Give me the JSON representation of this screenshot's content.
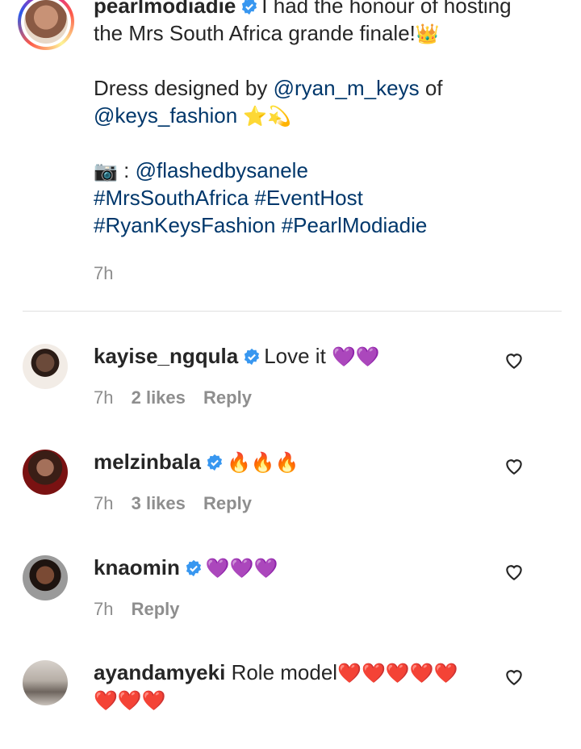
{
  "post": {
    "username": "pearlmodiadie",
    "text_line1": "I had the honour of hosting",
    "text_line2": "the Mrs South Africa grande finale!",
    "crown_emoji": "👑",
    "dress_prefix": "Dress designed by",
    "designer_handle": "@ryan_m_keys",
    "dress_of": "of",
    "brand_handle": "@keys_fashion",
    "star_emojis": "⭐💫",
    "camera_emoji": "📷",
    "photo_sep": ":",
    "photographer_handle": "@flashedbysanele",
    "hashtag1": "#MrsSouthAfrica",
    "hashtag2": "#EventHost",
    "hashtag3": "#RyanKeysFashion",
    "hashtag4": "#PearlModiadie",
    "time": "7h"
  },
  "comments": [
    {
      "username": "kayise_ngqula",
      "text": "Love it",
      "emoji": "💜💜",
      "time": "7h",
      "likes": "2 likes",
      "reply": "Reply"
    },
    {
      "username": "melzinbala",
      "text": "",
      "emoji": "🔥🔥🔥",
      "time": "7h",
      "likes": "3 likes",
      "reply": "Reply"
    },
    {
      "username": "knaomin",
      "text": "",
      "emoji": "💜💜💜",
      "time": "7h",
      "likes": "",
      "reply": "Reply"
    },
    {
      "username": "ayandamyeki",
      "text": "Role model",
      "emoji": "❤️❤️❤️❤️❤️",
      "emoji2": "❤️❤️❤️"
    }
  ],
  "icons": {
    "verified": "verified-badge-icon",
    "like": "heart-outline-icon"
  },
  "colors": {
    "link": "#00376b",
    "meta": "#8e8e8e",
    "verified": "#3897f0"
  }
}
